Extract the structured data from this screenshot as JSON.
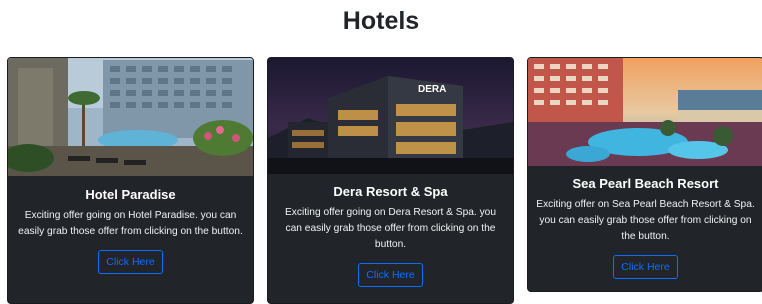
{
  "page": {
    "title": "Hotels"
  },
  "colors": {
    "card_bg": "#212529",
    "button_outline": "#0d6efd",
    "text": "#ffffff",
    "heading": "#212529"
  },
  "cards": [
    {
      "title": "Hotel Paradise",
      "text": "Exciting offer going on Hotel Paradise. you can easily grab those offer from clicking on the button.",
      "button_label": "Click Here",
      "image_icon": "hotel-pool-photo"
    },
    {
      "title": "Dera Resort & Spa",
      "text": "Exciting offer going on Dera Resort & Spa. you can easily grab those offer from clicking on the button.",
      "button_label": "Click Here",
      "image_icon": "resort-night-photo"
    },
    {
      "title": "Sea Pearl Beach Resort",
      "text": "Exciting offer on Sea Pearl Beach Resort & Spa. you can easily grab those offer from clicking on the button.",
      "button_label": "Click Here",
      "image_icon": "beach-resort-photo"
    }
  ]
}
